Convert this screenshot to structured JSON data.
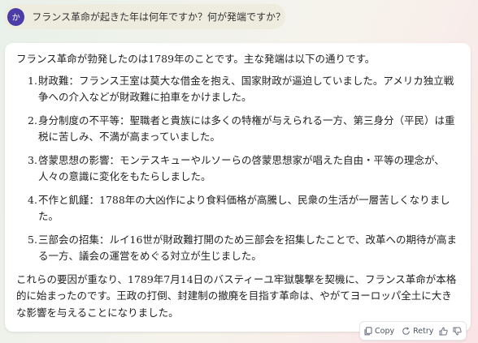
{
  "user": {
    "avatar_initial": "か",
    "question": "フランス革命が起きた年は何年ですか？何が発端ですか？"
  },
  "answer": {
    "intro": "フランス革命が勃発したのは1789年のことです。主な発端は以下の通りです。",
    "causes": [
      {
        "num": "1.",
        "text": "財政難：フランス王室は莫大な借金を抱え、国家財政が逼迫していました。アメリカ独立戦争への介入などが財政難に拍車をかけました。"
      },
      {
        "num": "2.",
        "text": "身分制度の不平等：聖職者と貴族には多くの特権が与えられる一方、第三身分（平民）は重税に苦しみ、不満が高まっていました。"
      },
      {
        "num": "3.",
        "text": "啓蒙思想の影響：モンテスキューやルソーらの啓蒙思想家が唱えた自由・平等の理念が、人々の意識に変化をもたらしました。"
      },
      {
        "num": "4.",
        "text": "不作と飢饉：1788年の大凶作により食料価格が高騰し、民衆の生活が一層苦しくなりました。"
      },
      {
        "num": "5.",
        "text": "三部会の招集：ルイ16世が財政難打開のため三部会を招集したことで、改革への期待が高まる一方、議会の運営をめぐる対立が生じました。"
      }
    ],
    "outro": "これらの要因が重なり、1789年7月14日のバスティーユ牢獄襲撃を契機に、フランス革命が本格的に始まったのです。王政の打倒、封建制の撤廃を目指す革命は、やがてヨーロッパ全土に大きな影響を与えることになりました。"
  },
  "actions": {
    "copy_label": "Copy",
    "retry_label": "Retry"
  },
  "icons": {
    "copy": "copy-icon",
    "retry": "retry-icon",
    "thumbs_up": "thumbs-up-icon",
    "thumbs_down": "thumbs-down-icon"
  },
  "colors": {
    "avatar_bg": "#4b3ca8",
    "user_bubble_bg": "#eeecde",
    "card_bg": "#ffffff"
  }
}
